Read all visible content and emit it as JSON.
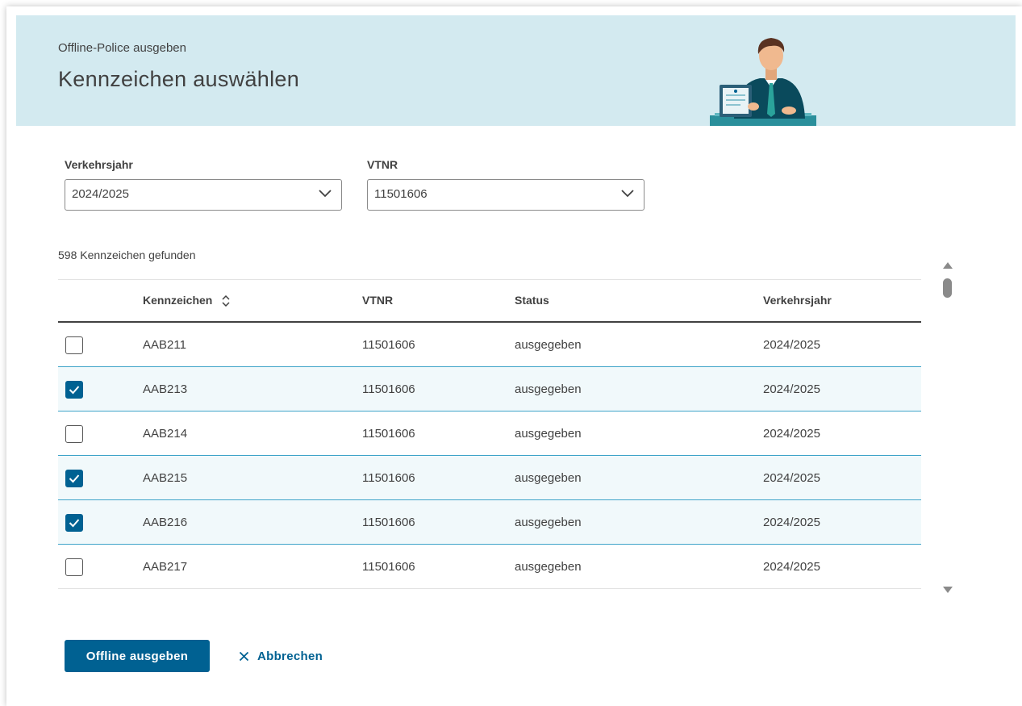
{
  "header": {
    "supertitle": "Offline-Police ausgeben",
    "title": "Kennzeichen auswählen"
  },
  "filters": {
    "year_label": "Verkehrsjahr",
    "year_value": "2024/2025",
    "vtnr_label": "VTNR",
    "vtnr_value": "11501606"
  },
  "results": {
    "count_text": "598 Kennzeichen gefunden"
  },
  "table": {
    "columns": [
      "Kennzeichen",
      "VTNR",
      "Status",
      "Verkehrsjahr"
    ],
    "rows": [
      {
        "kennzeichen": "AAB211",
        "vtnr": "11501606",
        "status": "ausgegeben",
        "jahr": "2024/2025",
        "checked": false
      },
      {
        "kennzeichen": "AAB213",
        "vtnr": "11501606",
        "status": "ausgegeben",
        "jahr": "2024/2025",
        "checked": true
      },
      {
        "kennzeichen": "AAB214",
        "vtnr": "11501606",
        "status": "ausgegeben",
        "jahr": "2024/2025",
        "checked": false
      },
      {
        "kennzeichen": "AAB215",
        "vtnr": "11501606",
        "status": "ausgegeben",
        "jahr": "2024/2025",
        "checked": true
      },
      {
        "kennzeichen": "AAB216",
        "vtnr": "11501606",
        "status": "ausgegeben",
        "jahr": "2024/2025",
        "checked": true
      },
      {
        "kennzeichen": "AAB217",
        "vtnr": "11501606",
        "status": "ausgegeben",
        "jahr": "2024/2025",
        "checked": false
      }
    ]
  },
  "actions": {
    "primary_label": "Offline ausgeben",
    "cancel_label": "Abbrechen"
  },
  "icons": {
    "sort": "sort-icon",
    "dropdown": "chevron-down-icon",
    "cancel": "close-icon",
    "checkbox_checked": "checkmark-icon"
  },
  "colors": {
    "banner_bg": "#d3eaf0",
    "primary": "#006192",
    "row_checked_bg": "#f1f9fb",
    "row_checked_border": "#3fa4c9",
    "text": "#414141"
  }
}
